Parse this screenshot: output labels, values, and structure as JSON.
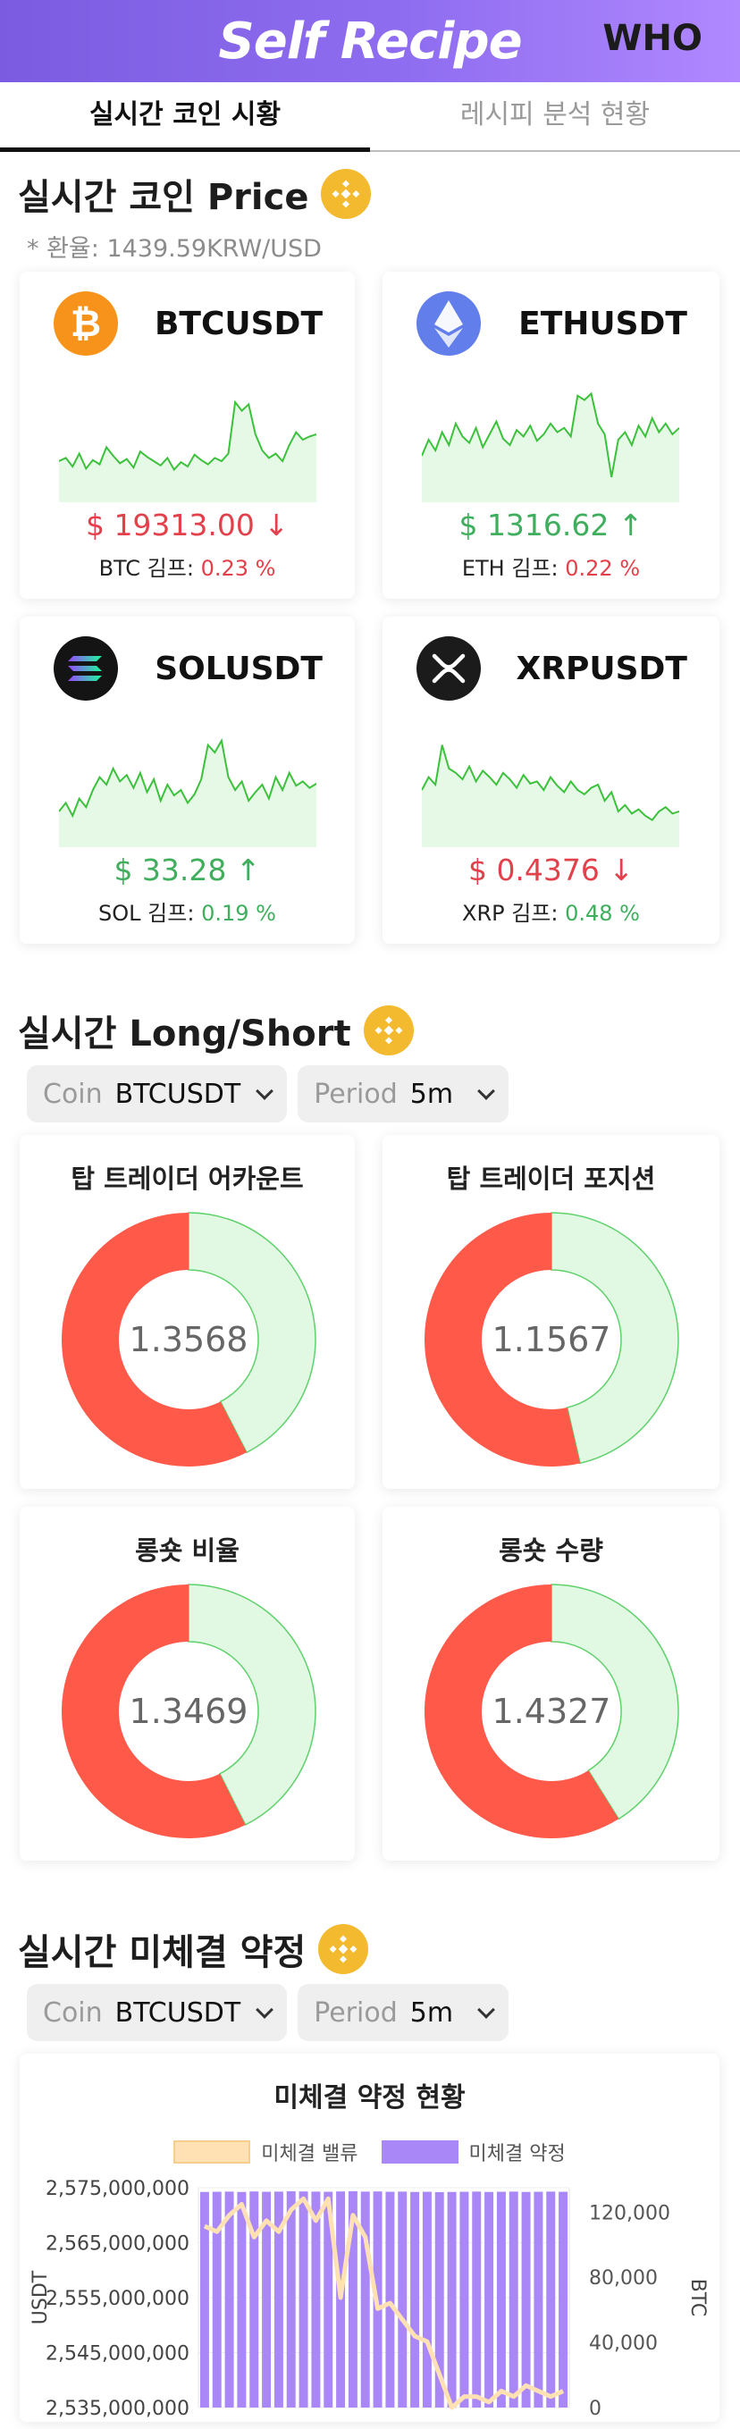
{
  "header": {
    "brand": "Self Recipe",
    "who": "WHO"
  },
  "tabs": [
    {
      "label": "실시간 코인 시황",
      "active": true
    },
    {
      "label": "레시피 분석 현황",
      "active": false
    }
  ],
  "price_section": {
    "title": "실시간 코인 Price",
    "icon": "binance-icon",
    "exchange_rate": "* 환율: 1439.59KRW/USD",
    "coins": [
      {
        "symbol": "BTCUSDT",
        "icon": "bitcoin-icon",
        "logo_color": "#f7931a",
        "price": "$ 19313.00 ↓",
        "direction": "down",
        "kimp_label": "BTC 김프:",
        "kimp_value": "0.23 %",
        "kimp_dir": "down",
        "spark": [
          0.35,
          0.38,
          0.3,
          0.42,
          0.28,
          0.36,
          0.32,
          0.48,
          0.4,
          0.33,
          0.37,
          0.29,
          0.44,
          0.39,
          0.35,
          0.31,
          0.38,
          0.27,
          0.34,
          0.3,
          0.41,
          0.36,
          0.32,
          0.38,
          0.35,
          0.42,
          0.9,
          0.82,
          0.88,
          0.6,
          0.45,
          0.38,
          0.42,
          0.35,
          0.5,
          0.62,
          0.55,
          0.58,
          0.6
        ]
      },
      {
        "symbol": "ETHUSDT",
        "icon": "ethereum-icon",
        "logo_color": "#627eea",
        "price": "$ 1316.62 ↑",
        "direction": "up",
        "kimp_label": "ETH 김프:",
        "kimp_value": "0.22 %",
        "kimp_dir": "down",
        "spark": [
          0.4,
          0.55,
          0.45,
          0.62,
          0.5,
          0.7,
          0.58,
          0.52,
          0.66,
          0.48,
          0.6,
          0.72,
          0.56,
          0.5,
          0.64,
          0.58,
          0.68,
          0.54,
          0.6,
          0.7,
          0.62,
          0.66,
          0.58,
          0.96,
          0.92,
          0.98,
          0.7,
          0.6,
          0.2,
          0.55,
          0.62,
          0.5,
          0.68,
          0.58,
          0.75,
          0.62,
          0.7,
          0.6,
          0.66
        ]
      },
      {
        "symbol": "SOLUSDT",
        "icon": "solana-icon",
        "logo_color": "#141414",
        "price": "$ 33.28 ↑",
        "direction": "up",
        "kimp_label": "SOL 김프:",
        "kimp_value": "0.19 %",
        "kimp_dir": "up",
        "spark": [
          0.3,
          0.38,
          0.26,
          0.42,
          0.34,
          0.5,
          0.62,
          0.55,
          0.7,
          0.58,
          0.64,
          0.52,
          0.66,
          0.48,
          0.6,
          0.4,
          0.55,
          0.45,
          0.5,
          0.38,
          0.46,
          0.6,
          0.92,
          0.85,
          0.96,
          0.62,
          0.5,
          0.58,
          0.4,
          0.48,
          0.55,
          0.42,
          0.62,
          0.5,
          0.66,
          0.54,
          0.58,
          0.52,
          0.56
        ]
      },
      {
        "symbol": "XRPUSDT",
        "icon": "xrp-icon",
        "logo_color": "#1b1b1b",
        "price": "$ 0.4376 ↓",
        "direction": "down",
        "kimp_label": "XRP 김프:",
        "kimp_value": "0.48 %",
        "kimp_dir": "up",
        "spark": [
          0.5,
          0.62,
          0.55,
          0.92,
          0.7,
          0.66,
          0.6,
          0.72,
          0.58,
          0.68,
          0.62,
          0.55,
          0.66,
          0.6,
          0.52,
          0.64,
          0.56,
          0.58,
          0.5,
          0.62,
          0.54,
          0.48,
          0.58,
          0.5,
          0.46,
          0.52,
          0.55,
          0.4,
          0.48,
          0.3,
          0.36,
          0.28,
          0.32,
          0.26,
          0.22,
          0.3,
          0.34,
          0.28,
          0.3
        ]
      }
    ]
  },
  "longshort_section": {
    "title": "실시간 Long/Short",
    "icon": "binance-icon",
    "coin_filter": {
      "label": "Coin",
      "value": "BTCUSDT"
    },
    "period_filter": {
      "label": "Period",
      "value": "5m"
    },
    "charts": [
      {
        "title": "탑 트레이더 어카운트",
        "value": "1.3568",
        "long_ratio": 0.5757
      },
      {
        "title": "탑 트레이더 포지션",
        "value": "1.1567",
        "long_ratio": 0.5363
      },
      {
        "title": "롱숏 비율",
        "value": "1.3469",
        "long_ratio": 0.5739
      },
      {
        "title": "롱숏 수량",
        "value": "1.4327",
        "long_ratio": 0.5889
      }
    ],
    "colors": {
      "long": "#ff5a49",
      "short": "#e1f8e3",
      "short_border": "#5fd16b"
    }
  },
  "oi_section": {
    "title": "실시간 미체결 약정",
    "icon": "binance-icon",
    "coin_filter": {
      "label": "Coin",
      "value": "BTCUSDT"
    },
    "period_filter": {
      "label": "Period",
      "value": "5m"
    },
    "chart_data": {
      "type": "bar",
      "title": "미체결 약정 현황",
      "legend": [
        "미체결 밸류",
        "미체결 약정"
      ],
      "ylabel_left": "USDT",
      "ylabel_right": "BTC",
      "left_ticks": [
        "2,575,000,000",
        "2,565,000,000",
        "2,555,000,000",
        "2,545,000,000",
        "2,535,000,000"
      ],
      "right_ticks": [
        "120,000",
        "80,000",
        "40,000",
        "0"
      ],
      "ylim_left": [
        2535000000,
        2575000000
      ],
      "ylim_right": [
        0,
        135000
      ],
      "series": [
        {
          "name": "미체결 약정",
          "axis": "right",
          "color": "#a987f7",
          "values": [
            132400,
            132500,
            132600,
            132400,
            132700,
            132500,
            132600,
            132800,
            132700,
            132600,
            132500,
            132700,
            132800,
            132600,
            132700,
            132500,
            132600,
            132400,
            132500,
            132300,
            132400,
            132500,
            132600,
            132400,
            132500,
            132600,
            132400,
            132500,
            132600,
            132500
          ]
        },
        {
          "name": "미체결 밸류",
          "axis": "left",
          "color": "#ffe1b4",
          "values": [
            2568000000,
            2567000000,
            2570000000,
            2572000000,
            2566000000,
            2569000000,
            2567000000,
            2571000000,
            2573000000,
            2569000000,
            2573000000,
            2555000000,
            2570000000,
            2566000000,
            2553000000,
            2554000000,
            2551000000,
            2548000000,
            2547000000,
            2541000000,
            2535000000,
            2537000000,
            2537000000,
            2536000000,
            2538000000,
            2537000000,
            2539000000,
            2538000000,
            2537000000,
            2538000000
          ]
        }
      ]
    }
  }
}
